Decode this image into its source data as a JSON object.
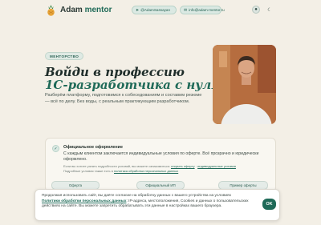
{
  "header": {
    "brand_first": "Adam",
    "brand_second": "mentor",
    "telegram": "@AdamSassayan",
    "email": "info@adam-mentor.ru"
  },
  "hero": {
    "pill": "МЕНТОРСТВО",
    "title_line1": "Войди в профессию",
    "title_line2": "1С-разработчика с нуля",
    "lead": "Разберём платформу, подготовимся к собеседованиям и составим резюме — всё по делу. Без воды, с реальным практикующим разработчиком."
  },
  "card": {
    "title": "Официальное оформление",
    "text": "С каждым клиентом заключается индивидуальные условия по оферте. Всё прозрачно и юридически оформлено.",
    "small_prefix": "Если вы хотите узнать подробности условий, вы можете ознакомиться:",
    "link1": "открыть оферту",
    "link2": "индивидуальные условия",
    "small_line2_prefix": "Подробные условия также есть в",
    "link3": "политика обработки персональных данных"
  },
  "mini_buttons": [
    "Оферта",
    "Официальный ИП",
    "Пример оферты"
  ],
  "cookie": {
    "text_before": "Продолжая использовать сайт, вы даёте согласие на обработку данных с вашего устройства на условиях",
    "link": "Политики обработки персональных данных",
    "text_after": ": IP-адреса, местоположения, Cookies и данных о пользовательских действиях на сайте. Вы можете запретить обрабатывать эти данные в настройках вашего браузера.",
    "ok_label": "OK"
  },
  "colors": {
    "accent": "#1f6a58",
    "background": "#f3efe6"
  },
  "icons": {
    "logo": "pineapple-logo-icon",
    "telegram": "telegram-icon",
    "mail": "mail-icon",
    "profile": "avatar-icon",
    "theme": "moon-icon",
    "card": "shield-icon"
  }
}
